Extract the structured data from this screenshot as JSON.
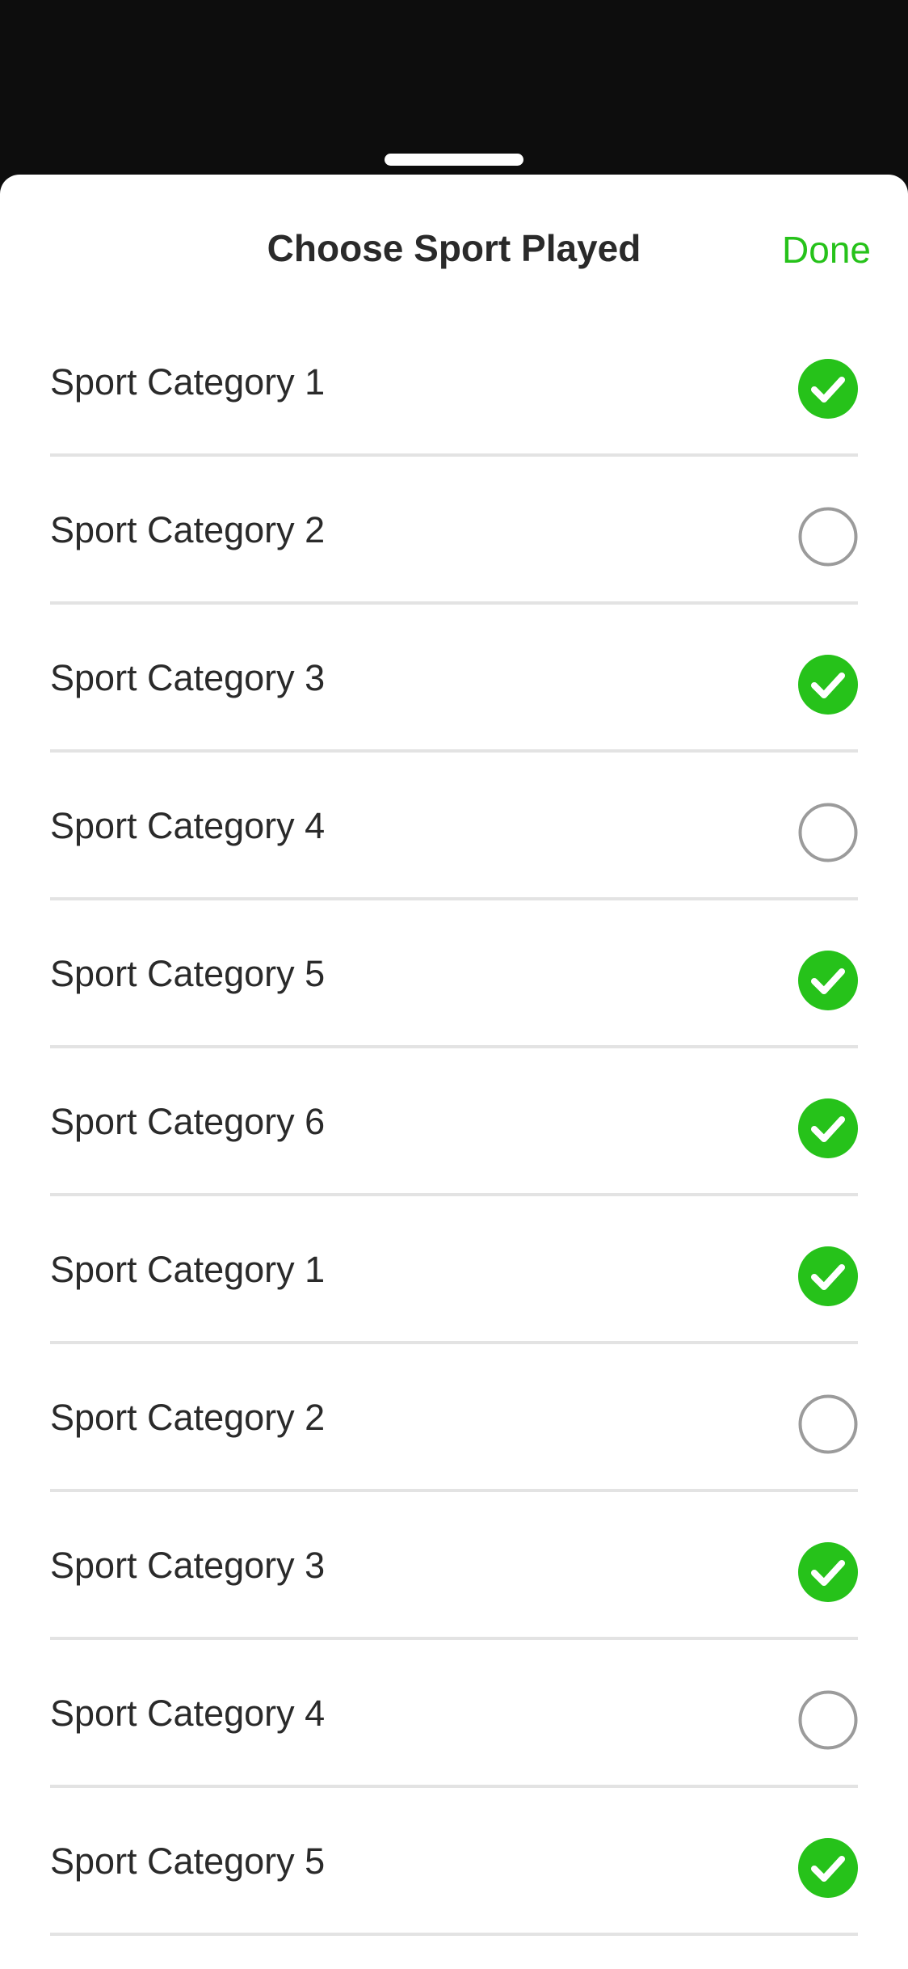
{
  "header": {
    "title": "Choose Sport Played",
    "done_label": "Done"
  },
  "colors": {
    "accent": "#26c21a",
    "unchecked": "#9b9b9b",
    "divider": "#e3e3e3"
  },
  "list": {
    "items": [
      {
        "label": "Sport Category 1",
        "checked": true
      },
      {
        "label": "Sport Category 2",
        "checked": false
      },
      {
        "label": "Sport Category 3",
        "checked": true
      },
      {
        "label": "Sport Category 4",
        "checked": false
      },
      {
        "label": "Sport Category 5",
        "checked": true
      },
      {
        "label": "Sport Category 6",
        "checked": true
      },
      {
        "label": "Sport Category 1",
        "checked": true
      },
      {
        "label": "Sport Category 2",
        "checked": false
      },
      {
        "label": "Sport Category 3",
        "checked": true
      },
      {
        "label": "Sport Category 4",
        "checked": false
      },
      {
        "label": "Sport Category 5",
        "checked": true
      }
    ]
  }
}
